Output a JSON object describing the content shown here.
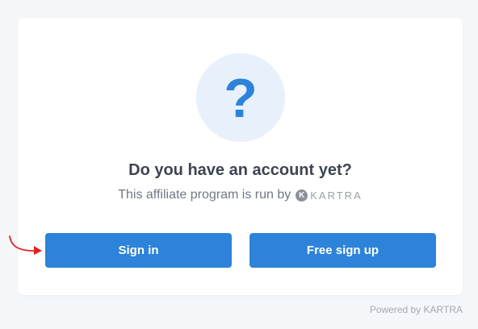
{
  "prompt": {
    "icon": "question-mark-icon",
    "icon_glyph": "?",
    "heading": "Do you have an account yet?",
    "subtitle": "This affiliate program is run by",
    "brand_mark": "K",
    "brand_name": "KARTRA"
  },
  "buttons": {
    "sign_in": "Sign in",
    "free_sign_up": "Free sign up"
  },
  "footer": {
    "powered_by": "Powered by KARTRA"
  },
  "colors": {
    "accent": "#2c83d9",
    "icon_bg": "#e7f0fb",
    "annotation_arrow": "#e02020"
  }
}
